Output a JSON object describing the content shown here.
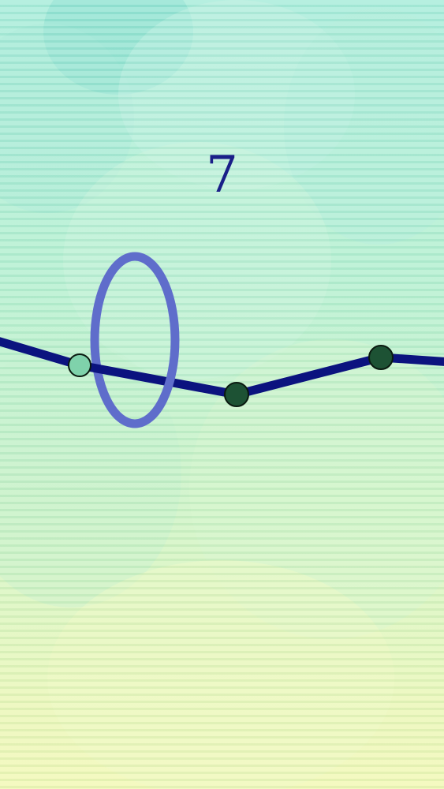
{
  "hud": {
    "score": "7"
  },
  "colors": {
    "track": "#0b137f",
    "ring": "#5f6dcb",
    "node_passed": "#7fd2ab",
    "node_upcoming": "#1d5234",
    "score_text": "#1a1f88",
    "node_outline": "#0a1a10"
  },
  "nodes": [
    {
      "state": "passed"
    },
    {
      "state": "upcoming"
    },
    {
      "state": "upcoming"
    }
  ]
}
